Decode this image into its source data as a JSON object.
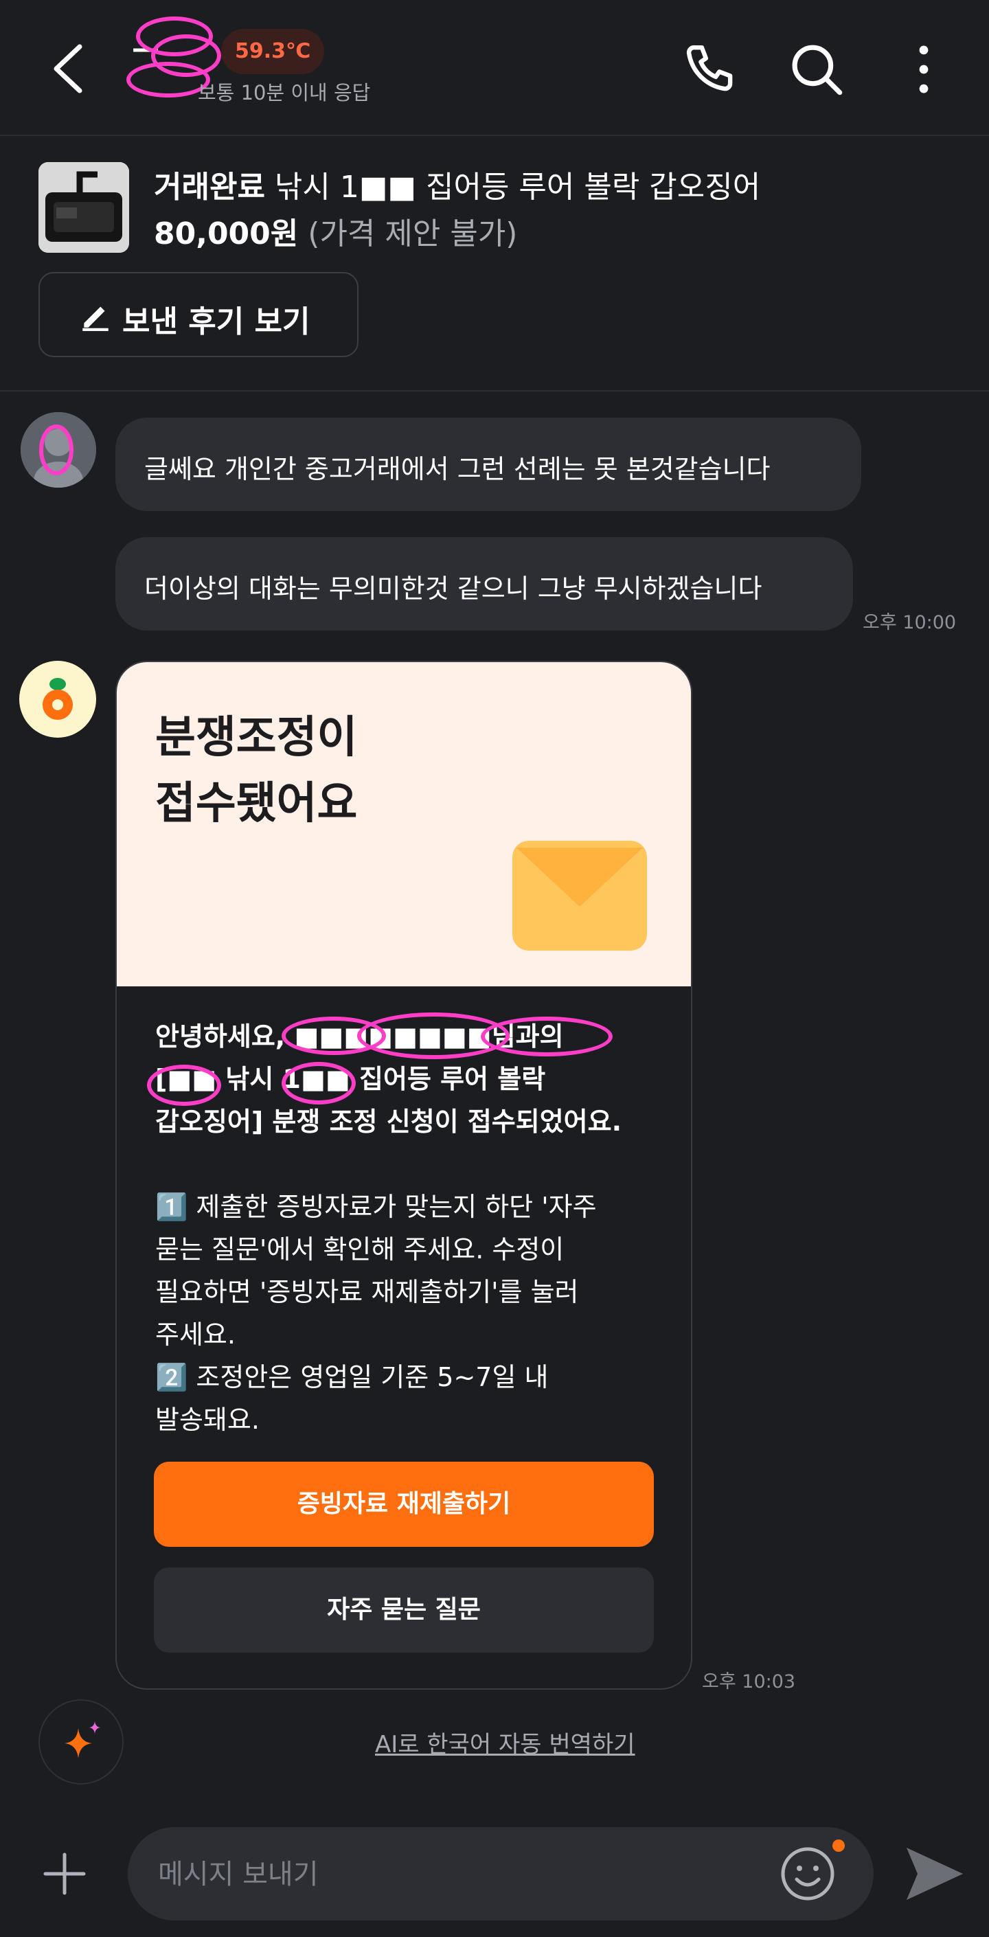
{
  "header": {
    "seller_name": "—",
    "temperature": "59.3℃",
    "response_time": "보통 10분 이내 응답",
    "back_icon": "chevron-left-icon",
    "call_icon": "phone-icon",
    "search_icon": "search-icon",
    "more_icon": "more-vertical-icon"
  },
  "product": {
    "status": "거래완료",
    "title": "낚시 1■■ 집어등 루어 볼락 갑오징어",
    "price": "80,000원",
    "price_note": "(가격 제안 불가)",
    "review_button": "보낸 후기 보기"
  },
  "messages": [
    {
      "text": "글쎄요 개인간 중고거래에서 그런 선례는 못 본것같습니다"
    },
    {
      "text": "더이상의 대화는 무의미한것 같으니 그냥 무시하겠습니다",
      "time": "오후 10:00"
    }
  ],
  "card": {
    "heading_line1": "분쟁조정이",
    "heading_line2": "접수됐어요",
    "intro_line1": "안녕하세요, ■■■■■■■■님과의",
    "intro_line2": "[■■ 낚시 1■■ 집어등 루어 볼락",
    "intro_line3": "갑오징어] 분쟁 조정 신청이 접수되었어요.",
    "step1_line1": "1️⃣ 제출한 증빙자료가 맞는지 하단 '자주",
    "step1_line2": "묻는 질문'에서 확인해 주세요. 수정이",
    "step1_line3": "필요하면 '증빙자료 재제출하기'를 눌러",
    "step1_line4": "주세요.",
    "step2_line1": "2️⃣ 조정안은 영업일 기준 5~7일 내",
    "step2_line2": "발송돼요.",
    "primary_button": "증빙자료 재제출하기",
    "secondary_button": "자주 묻는 질문",
    "time": "오후 10:03"
  },
  "ai_translate": "AI로 한국어 자동 번역하기",
  "input": {
    "placeholder": "메시지 보내기"
  },
  "colors": {
    "accent": "#ff6f0f",
    "background": "#1c1d21",
    "bubble": "#2c2e34",
    "card_top": "#fff1e8"
  }
}
